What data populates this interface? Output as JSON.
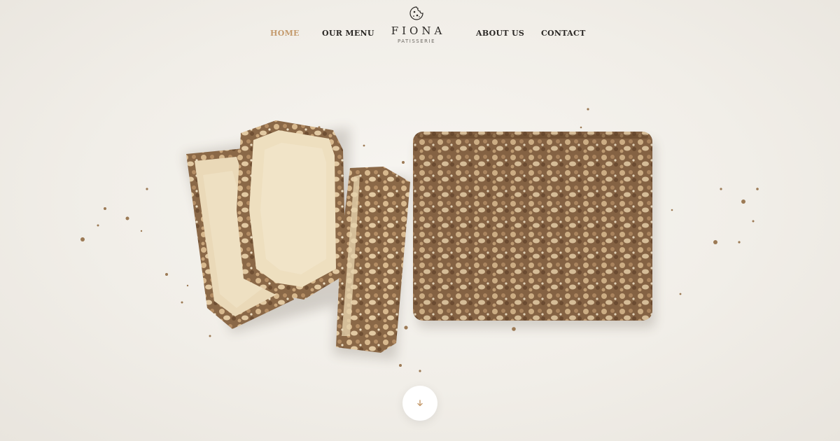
{
  "brand": {
    "name": "FIONA",
    "subtitle": "PATISSERIE",
    "logo_icon": "cookie-icon"
  },
  "nav": {
    "items": [
      {
        "label": "HOME",
        "active": true
      },
      {
        "label": "OUR MENU",
        "active": false
      },
      {
        "label": "ABOUT US",
        "active": false
      },
      {
        "label": "CONTACT",
        "active": false
      }
    ]
  },
  "hero": {
    "image": "sliced-nut-crumble-loaf-cake",
    "scroll_icon": "arrow-down-icon"
  },
  "colors": {
    "accent": "#c49a6c",
    "text": "#2b2825",
    "background": "#f3f0eb"
  }
}
